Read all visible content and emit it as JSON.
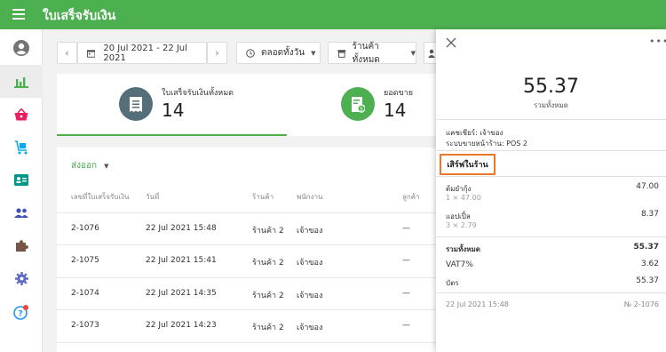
{
  "app": {
    "title": "ใบเสร็จรับเงิน"
  },
  "sidebar": {
    "items": [
      {
        "name": "account",
        "icon": "account-circle-icon",
        "color": "#757575"
      },
      {
        "name": "reports",
        "icon": "bar-chart-icon",
        "color": "#4caf50"
      },
      {
        "name": "items",
        "icon": "basket-icon",
        "color": "#e91e63"
      },
      {
        "name": "inventory",
        "icon": "inventory-cart-icon",
        "color": "#03a9f4"
      },
      {
        "name": "customers",
        "icon": "customer-card-icon",
        "color": "#009688"
      },
      {
        "name": "employees",
        "icon": "people-icon",
        "color": "#3f51b5"
      },
      {
        "name": "integrations",
        "icon": "puzzle-icon",
        "color": "#795548"
      },
      {
        "name": "settings",
        "icon": "gear-icon",
        "color": "#5c6bc0"
      },
      {
        "name": "help",
        "icon": "help-icon",
        "color": "#2196f3"
      }
    ]
  },
  "toolbar": {
    "date_range": "20 Jul 2021 - 22 Jul 2021",
    "time_filter": "ตลอดทั้งวัน",
    "store_filter": "ร้านค้าทั้งหมด"
  },
  "summary": {
    "receipts_label": "ใบเสร็จรับเงินทั้งหมด",
    "receipts_value": "14",
    "sales_label": "ยอดขาย",
    "sales_value": "14"
  },
  "table": {
    "export_label": "ส่งออก",
    "columns": [
      "เลขที่ใบเสร็จรับเงิน",
      "วันที่",
      "ร้านค้า",
      "พนักงาน",
      "ลูกค้า"
    ],
    "rows": [
      {
        "number": "2-1076",
        "date": "22 Jul 2021 15:48",
        "store": "ร้านค้า 2",
        "employee": "เจ้าของ",
        "customer": "—"
      },
      {
        "number": "2-1075",
        "date": "22 Jul 2021 15:41",
        "store": "ร้านค้า 2",
        "employee": "เจ้าของ",
        "customer": "—"
      },
      {
        "number": "2-1074",
        "date": "22 Jul 2021 14:35",
        "store": "ร้านค้า 2",
        "employee": "เจ้าของ",
        "customer": "—"
      },
      {
        "number": "2-1073",
        "date": "22 Jul 2021 14:23",
        "store": "ร้านค้า 2",
        "employee": "เจ้าของ",
        "customer": "—"
      }
    ]
  },
  "receipt": {
    "total": "55.37",
    "total_label": "รวมทั้งหมด",
    "cashier": "แคชเชียร์: เจ้าของ",
    "pos": "ระบบขายหน้าร้าน: POS 2",
    "dining": "เสิร์ฟในร้าน",
    "items": [
      {
        "name": "ต้มยำกุ้ง",
        "qty": "1 × 47.00",
        "amount": "47.00"
      },
      {
        "name": "แอปเปิ้ล",
        "qty": "3 × 2.79",
        "amount": "8.37"
      }
    ],
    "totals": [
      {
        "label": "รวมทั้งหมด",
        "value": "55.37"
      },
      {
        "label": "VAT7%",
        "value": "3.62"
      },
      {
        "label": "บัตร",
        "value": "55.37"
      }
    ],
    "date": "22 Jul 2021 15:48",
    "number": "№ 2-1076"
  },
  "colors": {
    "primary": "#4caf50",
    "highlight": "#e8792a",
    "receipt_icon_bg": "#546e7a",
    "sales_icon_bg": "#4caf50"
  }
}
